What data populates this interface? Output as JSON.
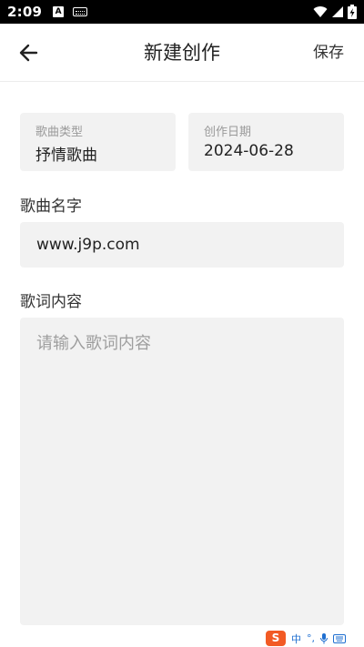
{
  "status_bar": {
    "time": "2:09",
    "icons": [
      "notification-a-icon",
      "keyboard-icon",
      "wifi-icon",
      "signal-icon",
      "battery-charging-icon"
    ]
  },
  "app_bar": {
    "title": "新建创作",
    "save_label": "保存",
    "back_icon": "arrow-left-icon"
  },
  "form": {
    "song_type": {
      "label": "歌曲类型",
      "value": "抒情歌曲"
    },
    "created_date": {
      "label": "创作日期",
      "value": "2024-06-28"
    },
    "song_name": {
      "label": "歌曲名字",
      "value": "www.j9p.com"
    },
    "lyrics": {
      "label": "歌词内容",
      "placeholder": "请输入歌词内容",
      "value": ""
    }
  },
  "ime_toolbar": {
    "logo": "S",
    "mode": "中",
    "icons": [
      "punctuation-icon",
      "microphone-icon",
      "keyboard-icon"
    ]
  },
  "colors": {
    "status_bar_bg": "#000000",
    "field_bg": "#f2f2f2",
    "placeholder": "#9e9e9e",
    "ime_logo": "#f25a24",
    "ime_accent": "#1f6fd0"
  }
}
